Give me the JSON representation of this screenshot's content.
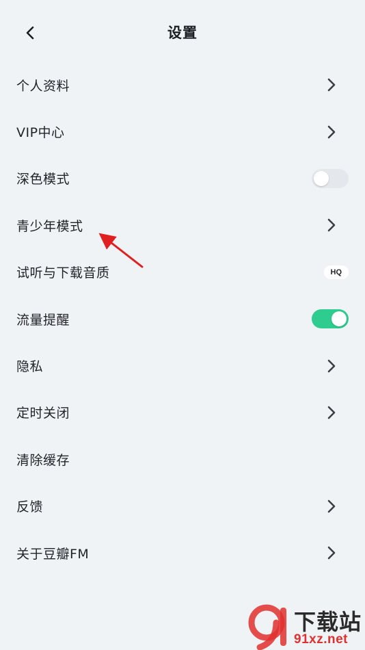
{
  "header": {
    "title": "设置",
    "back_icon": "chevron-left-icon"
  },
  "settings": {
    "items": [
      {
        "label": "个人资料",
        "control": "chevron"
      },
      {
        "label": "VIP中心",
        "control": "chevron"
      },
      {
        "label": "深色模式",
        "control": "toggle",
        "state": "off"
      },
      {
        "label": "青少年模式",
        "control": "chevron"
      },
      {
        "label": "试听与下载音质",
        "control": "badge",
        "badge": "HQ"
      },
      {
        "label": "流量提醒",
        "control": "toggle",
        "state": "on"
      },
      {
        "label": "隐私",
        "control": "chevron"
      },
      {
        "label": "定时关闭",
        "control": "chevron"
      },
      {
        "label": "清除缓存",
        "control": "none"
      },
      {
        "label": "反馈",
        "control": "chevron"
      },
      {
        "label": "关于豆瓣FM",
        "control": "chevron"
      }
    ]
  },
  "watermark": {
    "title": "下载站",
    "domain": "91xz.net"
  },
  "colors": {
    "background": "#f0f3f6",
    "toggle_on": "#2ecc8f",
    "toggle_off": "#e4e7eb",
    "annotation_arrow": "#e02020",
    "watermark_red": "#e0302f"
  }
}
